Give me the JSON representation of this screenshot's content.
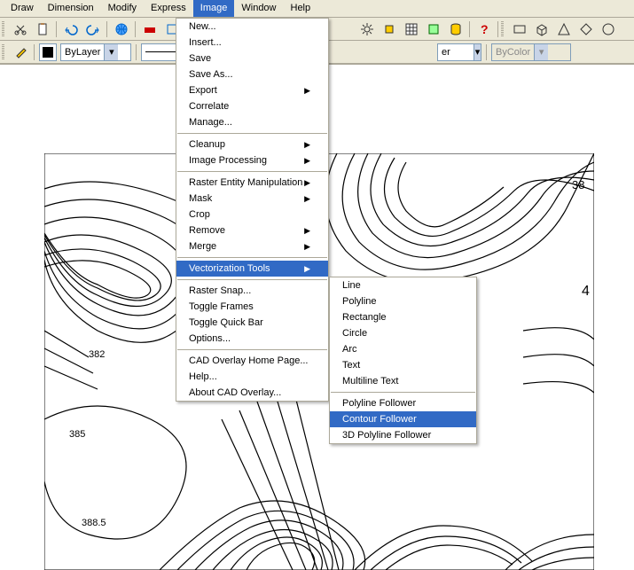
{
  "menubar": [
    "Draw",
    "Dimension",
    "Modify",
    "Express",
    "Image",
    "Window",
    "Help"
  ],
  "menubar_active_index": 4,
  "layer_combo": "ByLayer",
  "layerdrop_label": "er",
  "color_label": "ByColor",
  "image_menu": {
    "group1": [
      "New...",
      "Insert...",
      "Save",
      "Save As...",
      "Export",
      "Correlate",
      "Manage..."
    ],
    "group1_sub_flags": [
      false,
      false,
      false,
      false,
      true,
      false,
      false
    ],
    "group2": [
      "Cleanup",
      "Image Processing"
    ],
    "group2_sub_flags": [
      true,
      true
    ],
    "group3": [
      "Raster Entity Manipulation",
      "Mask",
      "Crop",
      "Remove",
      "Merge"
    ],
    "group3_sub_flags": [
      true,
      true,
      false,
      true,
      true
    ],
    "group4": [
      "Vectorization Tools"
    ],
    "group4_highlight_index": 0,
    "group5": [
      "Raster Snap...",
      "Toggle Frames",
      "Toggle Quick Bar",
      "Options..."
    ],
    "group6": [
      "CAD Overlay Home Page...",
      "Help...",
      "About CAD Overlay..."
    ]
  },
  "vectorization_submenu": {
    "group1": [
      "Line",
      "Polyline",
      "Rectangle",
      "Circle",
      "Arc",
      "Text",
      "Multiline Text"
    ],
    "group2": [
      "Polyline Follower",
      "Contour Follower",
      "3D Polyline Follower"
    ],
    "group2_highlight_index": 1
  },
  "canvas_labels": {
    "l1": "382",
    "l2": "385",
    "l3": "388.5",
    "l4": "4",
    "l5": "38"
  }
}
